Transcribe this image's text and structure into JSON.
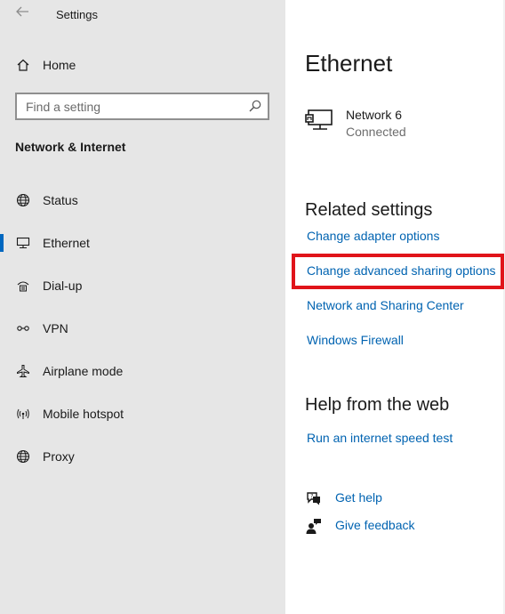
{
  "window": {
    "title": "Settings",
    "back_icon": "back-arrow-icon"
  },
  "sidebar": {
    "home": {
      "label": "Home",
      "icon": "home-icon"
    },
    "search": {
      "placeholder": "Find a setting",
      "icon": "search-icon"
    },
    "section_heading": "Network & Internet",
    "items": [
      {
        "label": "Status",
        "icon": "globe-status-icon",
        "selected": false
      },
      {
        "label": "Ethernet",
        "icon": "ethernet-icon",
        "selected": true
      },
      {
        "label": "Dial-up",
        "icon": "dial-up-icon",
        "selected": false
      },
      {
        "label": "VPN",
        "icon": "vpn-icon",
        "selected": false
      },
      {
        "label": "Airplane mode",
        "icon": "airplane-icon",
        "selected": false
      },
      {
        "label": "Mobile hotspot",
        "icon": "hotspot-icon",
        "selected": false
      },
      {
        "label": "Proxy",
        "icon": "globe-icon",
        "selected": false
      }
    ]
  },
  "main": {
    "title": "Ethernet",
    "network": {
      "name": "Network 6",
      "status": "Connected",
      "icon": "monitor-network-icon"
    },
    "related_settings": {
      "heading": "Related settings",
      "links": [
        "Change adapter options",
        "Change advanced sharing options",
        "Network and Sharing Center",
        "Windows Firewall"
      ]
    },
    "help_web": {
      "heading": "Help from the web",
      "links": [
        "Run an internet speed test"
      ]
    },
    "help_actions": [
      {
        "label": "Get help",
        "icon": "get-help-icon"
      },
      {
        "label": "Give feedback",
        "icon": "feedback-icon"
      }
    ]
  },
  "colors": {
    "link": "#0063b1",
    "sidebar_bg": "#e6e6e6",
    "accent": "#0067c0",
    "highlight": "#e0141a"
  }
}
